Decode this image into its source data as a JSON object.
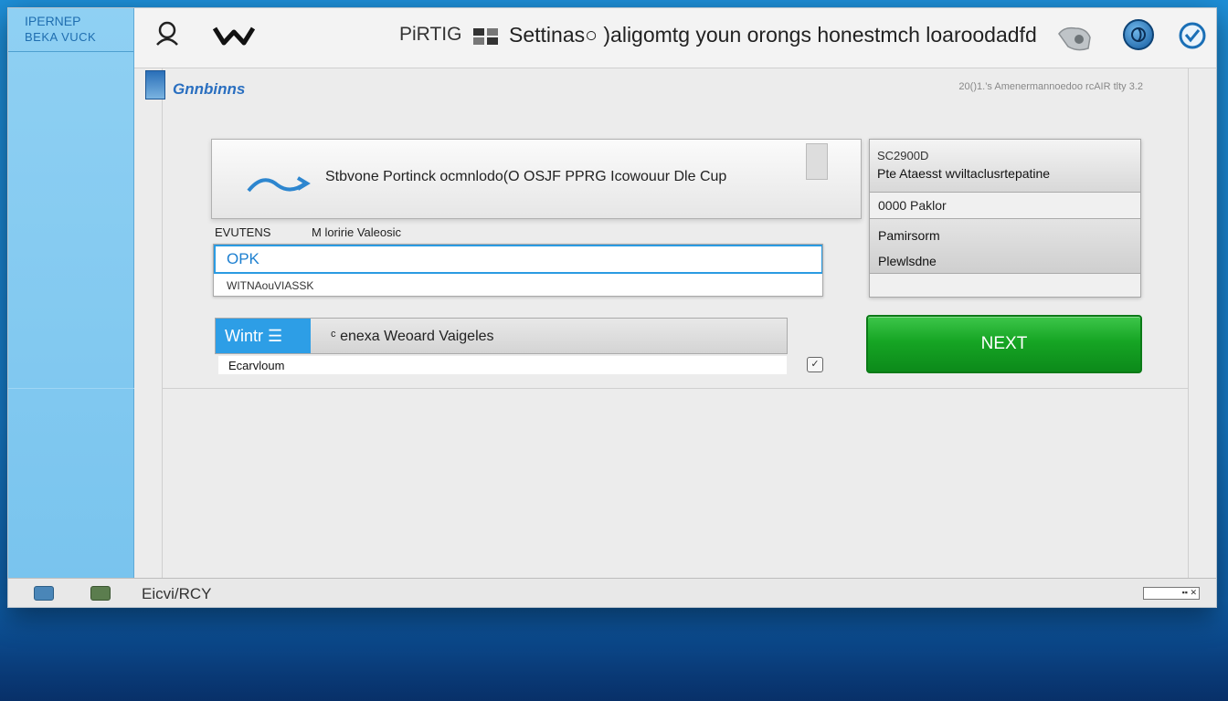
{
  "sidebar": {
    "brand_line1": "IPERNEP",
    "brand_line2": "BEKA VUCK"
  },
  "topbar": {
    "app_name": "PiRTIG",
    "title": "Settinas○ )aligomtg youn orongs honestmch loaroodadfd",
    "icons": [
      "user-icon",
      "logo-icon",
      "grid-icon",
      "cloud-icon",
      "globe-icon",
      "check-circle-icon"
    ]
  },
  "section": {
    "label": "Gnnbinns",
    "meta": "20()1.’s Amenermannoedoo rcAIR tlty 3.2"
  },
  "hero": {
    "text": "Stbvone Portinck ocmnlodo(O OSJF PPRG Icowouur Dle Cup"
  },
  "fields": {
    "label_left": "EVUTENS",
    "label_right": "M loririe Valeosic",
    "input_value": "OPK",
    "input_sub": "WITNAouVIASSK"
  },
  "tabs": {
    "active_label": "Wintr ☰",
    "text": "ᶜ enexa Weoard Vaigeles",
    "sub": "Ecarvloum",
    "check_label": "✓"
  },
  "side_panel": {
    "code": "SC2900D",
    "desc": "Pte Ataesst wviltaclusrtepatine",
    "row1": "0000 Paklor",
    "row2": "Pamirsorm",
    "row3": "Plewlsdne"
  },
  "next_button": "NEXT",
  "statusbar": {
    "text": "Eicvi/RCY",
    "right_box": "▪▪ ✕"
  },
  "colors": {
    "accent": "#2d9ee6",
    "next_green": "#16a524",
    "sidebar": "#8fd0f3",
    "desktop": "#1678c4"
  }
}
